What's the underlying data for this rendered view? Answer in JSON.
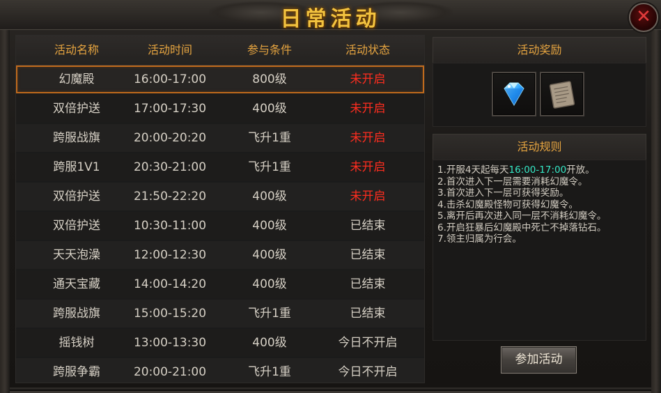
{
  "window": {
    "title": "日常活动",
    "close_icon": "✕"
  },
  "table": {
    "headers": [
      "活动名称",
      "活动时间",
      "参与条件",
      "活动状态"
    ],
    "rows": [
      {
        "name": "幻魔殿",
        "time": "16:00-17:00",
        "condition": "800级",
        "status": "未开启"
      },
      {
        "name": "双倍护送",
        "time": "17:00-17:30",
        "condition": "400级",
        "status": "未开启"
      },
      {
        "name": "跨服战旗",
        "time": "20:00-20:20",
        "condition": "飞升1重",
        "status": "未开启"
      },
      {
        "name": "跨服1V1",
        "time": "20:30-21:00",
        "condition": "飞升1重",
        "status": "未开启"
      },
      {
        "name": "双倍护送",
        "time": "21:50-22:20",
        "condition": "400级",
        "status": "未开启"
      },
      {
        "name": "双倍护送",
        "time": "10:30-11:00",
        "condition": "400级",
        "status": "已结束"
      },
      {
        "name": "天天泡澡",
        "time": "12:00-12:30",
        "condition": "400级",
        "status": "已结束"
      },
      {
        "name": "通天宝藏",
        "time": "14:00-14:20",
        "condition": "400级",
        "status": "已结束"
      },
      {
        "name": "跨服战旗",
        "time": "15:00-15:20",
        "condition": "飞升1重",
        "status": "已结束"
      },
      {
        "name": "摇钱树",
        "time": "13:00-13:30",
        "condition": "400级",
        "status": "今日不开启"
      },
      {
        "name": "跨服争霸",
        "time": "20:00-21:00",
        "condition": "飞升1重",
        "status": "今日不开启"
      }
    ],
    "selected_index": 0
  },
  "rewards": {
    "header": "活动奖励",
    "items": [
      "diamond-icon",
      "scroll-icon"
    ]
  },
  "rules": {
    "header": "活动规则",
    "line1_prefix": "1.开服4天起每天",
    "line1_highlight": "16:00-17:00",
    "line1_suffix": "开放。",
    "lines": [
      "2.首次进入下一层需要消耗幻魔令。",
      "3.首次进入下一层可获得奖励。",
      "4.击杀幻魔殿怪物可获得幻魔令。",
      "5.离开后再次进入同一层不消耗幻魔令。",
      "6.开启狂暴后幻魔殿中死亡不掉落钻石。",
      "7.领主归属为行会。"
    ]
  },
  "join_button": "参加活动",
  "colors": {
    "header_text": "#e7a540",
    "status_closed": "#ff2d1f",
    "highlight": "#35e8c6",
    "selected_border": "#c06a1c"
  }
}
